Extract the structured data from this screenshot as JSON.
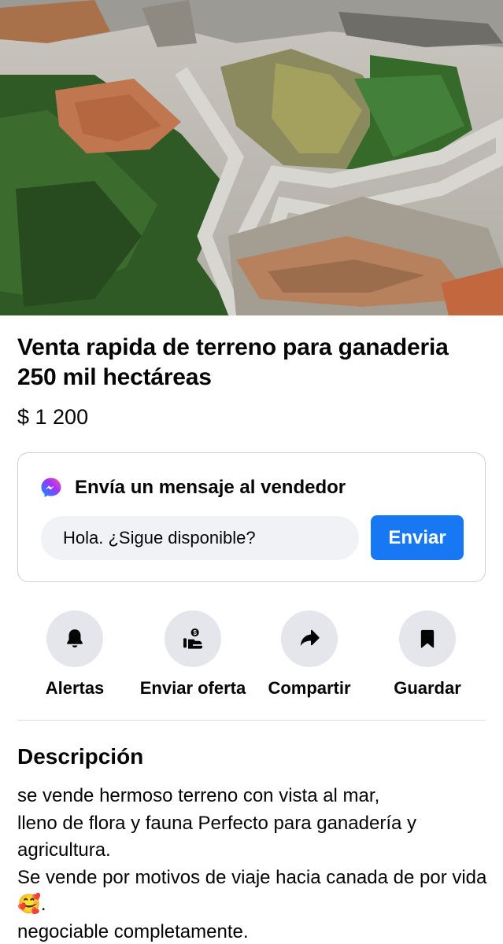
{
  "listing": {
    "title": "Venta rapida de terreno para ganaderia 250 mil hectáreas",
    "price": "$ 1 200"
  },
  "message_box": {
    "heading": "Envía un mensaje al vendedor",
    "input_value": "Hola. ¿Sigue disponible?",
    "send_label": "Enviar"
  },
  "actions": [
    {
      "label": "Alertas",
      "icon": "bell-icon"
    },
    {
      "label": "Enviar oferta",
      "icon": "offer-icon"
    },
    {
      "label": "Compartir",
      "icon": "share-icon"
    },
    {
      "label": "Guardar",
      "icon": "bookmark-icon"
    }
  ],
  "description": {
    "heading": "Descripción",
    "text": "se vende hermoso terreno con vista al mar,\nlleno de flora y fauna Perfecto para ganadería y agricultura.\nSe vende por motivos de viaje hacia canada de por vida🥰.\nnegociable completamente."
  },
  "colors": {
    "primary": "#1877f2",
    "icon_bg": "#e4e6eb",
    "input_bg": "#f0f2f5"
  }
}
